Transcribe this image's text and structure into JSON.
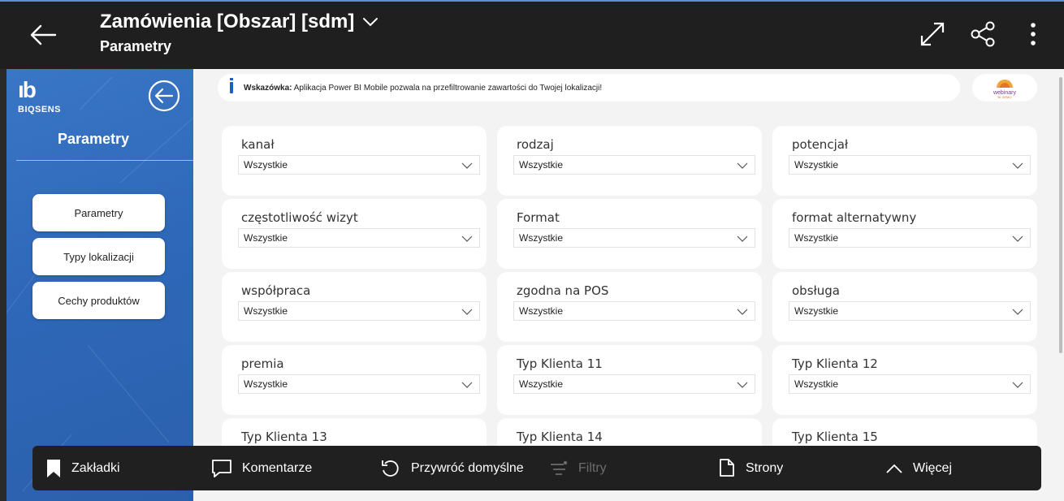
{
  "header": {
    "title": "Zamówienia [Obszar] [sdm]",
    "subtitle": "Parametry",
    "icons": [
      "back-arrow-icon",
      "chevron-down-icon",
      "expand-icon",
      "share-icon",
      "more-vertical-icon"
    ]
  },
  "sidebar": {
    "logo_mark": "ıb",
    "logo_text": "BIQSENS",
    "title": "Parametry",
    "buttons": [
      {
        "label": "Parametry"
      },
      {
        "label": "Typy lokalizacji"
      },
      {
        "label": "Cechy produktów"
      }
    ]
  },
  "tip": {
    "label": "Wskazówka:",
    "text": " Aplikacja Power BI Mobile pozwala na przefiltrowanie zawartości do Twojej lokalizacji!",
    "logo_text": "webinary",
    "logo_subtext": "BI DEMO"
  },
  "filters": [
    {
      "label": "kanał",
      "value": "Wszystkie"
    },
    {
      "label": "rodzaj",
      "value": "Wszystkie"
    },
    {
      "label": "potencjał",
      "value": "Wszystkie"
    },
    {
      "label": "częstotliwość wizyt",
      "value": "Wszystkie"
    },
    {
      "label": "Format",
      "value": "Wszystkie"
    },
    {
      "label": "format alternatywny",
      "value": "Wszystkie"
    },
    {
      "label": "współpraca",
      "value": "Wszystkie"
    },
    {
      "label": "zgodna na POS",
      "value": "Wszystkie"
    },
    {
      "label": "obsługa",
      "value": "Wszystkie"
    },
    {
      "label": "premia",
      "value": "Wszystkie"
    },
    {
      "label": "Typ Klienta 11",
      "value": "Wszystkie"
    },
    {
      "label": "Typ Klienta 12",
      "value": "Wszystkie"
    },
    {
      "label": "Typ Klienta 13",
      "value": ""
    },
    {
      "label": "Typ Klienta 14",
      "value": ""
    },
    {
      "label": "Typ Klienta 15",
      "value": ""
    }
  ],
  "bottombar": {
    "bookmarks": "Zakładki",
    "comments": "Komentarze",
    "reset": "Przywróć domyślne",
    "filters": "Filtry",
    "pages": "Strony",
    "more": "Więcej"
  },
  "colors": {
    "topbar": "#1f1f1f",
    "sidebar": "#2f68b9",
    "canvas": "#f3f3f3",
    "tip_accent": "#1d5fc4"
  }
}
